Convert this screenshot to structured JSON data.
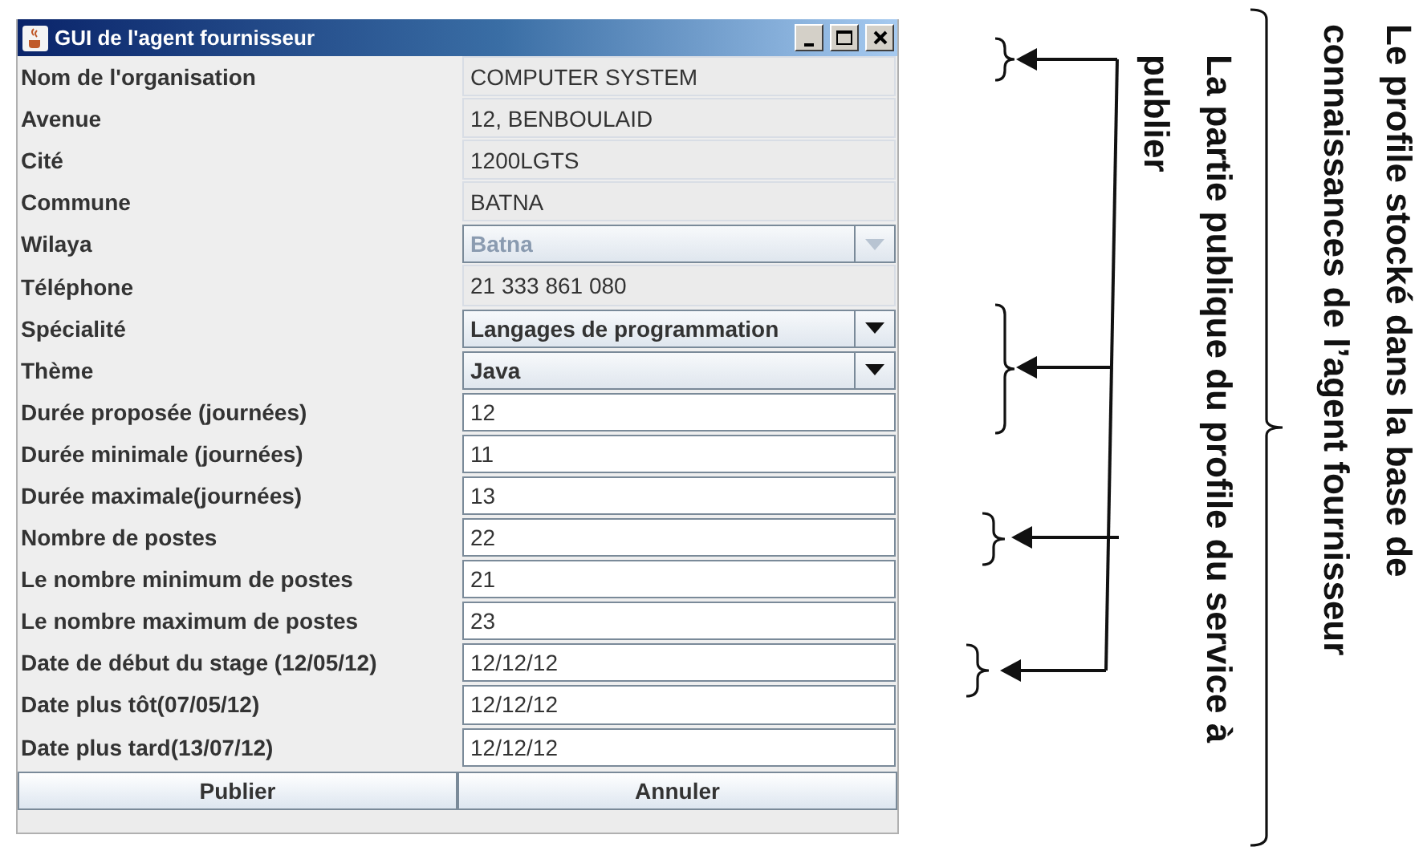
{
  "window": {
    "title": "GUI de l'agent fournisseur"
  },
  "fields": [
    {
      "label": "Nom de l'organisation",
      "kind": "static",
      "value": "COMPUTER SYSTEM"
    },
    {
      "label": "Avenue",
      "kind": "static",
      "value": "12, BENBOULAID"
    },
    {
      "label": "Cité",
      "kind": "static",
      "value": "1200LGTS"
    },
    {
      "label": "Commune",
      "kind": "static",
      "value": "BATNA"
    },
    {
      "label": "Wilaya",
      "kind": "combo",
      "value": "Batna",
      "disabled": true
    },
    {
      "label": "Téléphone",
      "kind": "static",
      "value": "21 333 861 080"
    },
    {
      "label": "Spécialité",
      "kind": "combo",
      "value": "Langages de programmation",
      "disabled": false
    },
    {
      "label": "Thème",
      "kind": "combo",
      "value": "Java",
      "disabled": false
    },
    {
      "label": "Durée proposée (journées)",
      "kind": "input",
      "value": "12"
    },
    {
      "label": "Durée minimale (journées)",
      "kind": "input",
      "value": "11"
    },
    {
      "label": "Durée maximale(journées)",
      "kind": "input",
      "value": "13"
    },
    {
      "label": "Nombre de postes",
      "kind": "input",
      "value": "22"
    },
    {
      "label": "Le nombre minimum de postes",
      "kind": "input",
      "value": "21"
    },
    {
      "label": "Le nombre maximum de postes",
      "kind": "input",
      "value": "23"
    },
    {
      "label": "Date de début du stage (12/05/12)",
      "kind": "input",
      "value": "12/12/12"
    },
    {
      "label": "Date plus tôt(07/05/12)",
      "kind": "input",
      "value": "12/12/12"
    },
    {
      "label": "Date plus tard(13/07/12)",
      "kind": "input",
      "value": "12/12/12"
    }
  ],
  "buttons": [
    "Publier",
    "Annuler"
  ],
  "annotations": {
    "outer": "Le profile stocké dans la base de connaissances de l’agent fournisseur",
    "inner": "La partie publique du profile du service à publier"
  }
}
